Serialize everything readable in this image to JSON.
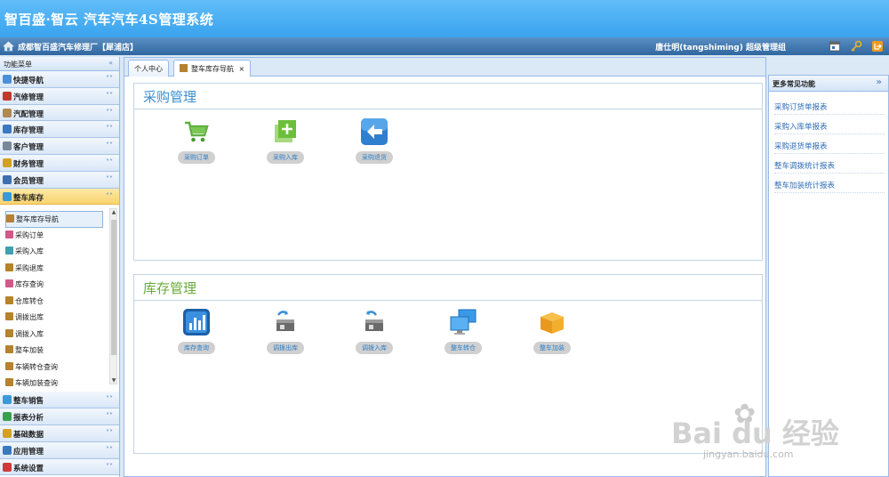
{
  "app": {
    "title": "智百盛·智云 汽车汽车4S管理系统"
  },
  "subbar": {
    "shop": "成都智百盛汽车修理厂【犀浦店】",
    "user": "唐仕明(tangshiming) 超级管理组"
  },
  "sidebar": {
    "title": "功能菜单",
    "top_sections": [
      {
        "label": "快捷导航",
        "icon": "compass-icon",
        "color": "#4a90d9"
      },
      {
        "label": "汽修管理",
        "icon": "tools-icon",
        "color": "#c0392b"
      },
      {
        "label": "汽配管理",
        "icon": "parts-icon",
        "color": "#b08850"
      },
      {
        "label": "库存管理",
        "icon": "stock-icon",
        "color": "#3a78c0"
      },
      {
        "label": "客户管理",
        "icon": "customer-icon",
        "color": "#7a8899"
      },
      {
        "label": "财务管理",
        "icon": "finance-icon",
        "color": "#d4a020"
      },
      {
        "label": "会员管理",
        "icon": "member-icon",
        "color": "#3a6fb0"
      },
      {
        "label": "整车库存",
        "icon": "car-stock-icon",
        "color": "#3a9ad9"
      }
    ],
    "sub_items": [
      {
        "label": "整车库存导航",
        "color": "#b5822e"
      },
      {
        "label": "采购订单",
        "color": "#d05a8a"
      },
      {
        "label": "采购入库",
        "color": "#3fa0b0"
      },
      {
        "label": "采购退库",
        "color": "#b5822e"
      },
      {
        "label": "库存查询",
        "color": "#d05a8a"
      },
      {
        "label": "仓库转仓",
        "color": "#b5822e"
      },
      {
        "label": "调拨出库",
        "color": "#b5822e"
      },
      {
        "label": "调拨入库",
        "color": "#b5822e"
      },
      {
        "label": "整车加装",
        "color": "#b5822e"
      },
      {
        "label": "车辆转仓查询",
        "color": "#b5822e"
      },
      {
        "label": "车辆加装查询",
        "color": "#b5822e"
      }
    ],
    "bottom_sections": [
      {
        "label": "整车销售",
        "icon": "sales-icon",
        "color": "#3a9ad9"
      },
      {
        "label": "报表分析",
        "icon": "report-icon",
        "color": "#3aa050"
      },
      {
        "label": "基础数据",
        "icon": "database-icon",
        "color": "#d4a020"
      },
      {
        "label": "应用管理",
        "icon": "app-icon",
        "color": "#3a78c0"
      },
      {
        "label": "系统设置",
        "icon": "settings-icon",
        "color": "#d03a3a"
      }
    ]
  },
  "tabs": [
    {
      "label": "个人中心"
    },
    {
      "label": "整车库存导航",
      "close": "×"
    }
  ],
  "purchase_panel": {
    "title": "采购管理",
    "title_color": "#3a8fd0",
    "items": [
      {
        "label": "采购订单",
        "icon": "cart-icon"
      },
      {
        "label": "采购入库",
        "icon": "add-icon"
      },
      {
        "label": "采购退货",
        "icon": "return-icon"
      }
    ]
  },
  "inventory_panel": {
    "title": "库存管理",
    "title_color": "#6aaa3a",
    "items": [
      {
        "label": "库存查询",
        "icon": "chart-icon"
      },
      {
        "label": "调拨出库",
        "icon": "transfer-out-icon"
      },
      {
        "label": "调拨入库",
        "icon": "transfer-in-icon"
      },
      {
        "label": "整车转仓",
        "icon": "monitor-icon"
      },
      {
        "label": "整车加装",
        "icon": "box-icon"
      }
    ]
  },
  "right_panel": {
    "title": "更多常见功能",
    "links": [
      "采购订货单报表",
      "采购入库单报表",
      "采购退货单报表",
      "整车调拨统计报表",
      "整车加装统计报表"
    ]
  },
  "watermark": {
    "text": "Bai du 经验",
    "url": "jingyan.baidu.com"
  }
}
